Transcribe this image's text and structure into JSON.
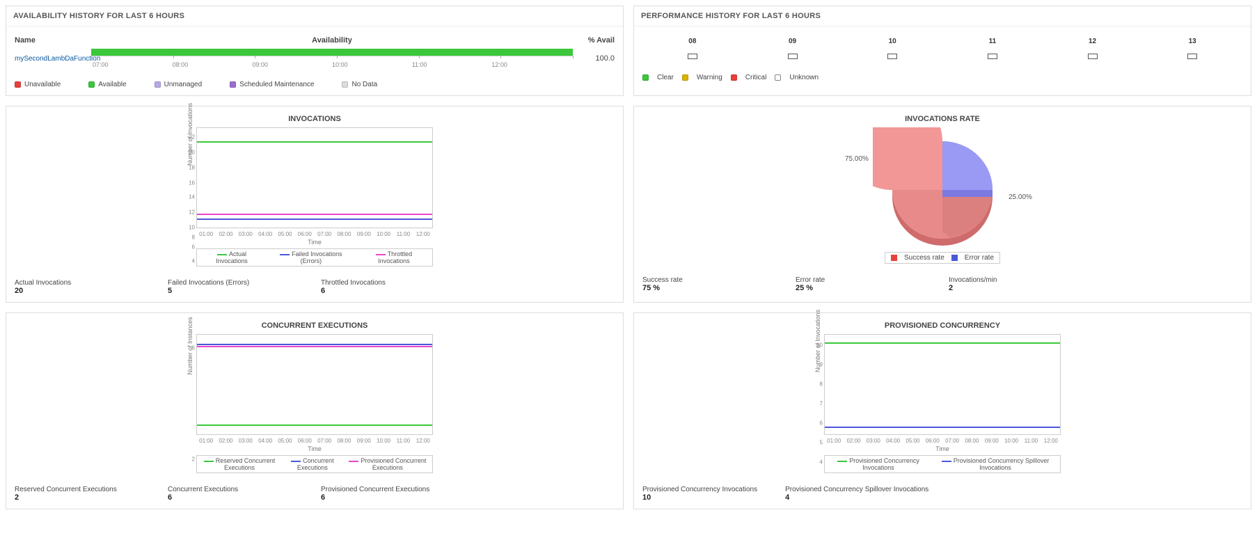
{
  "availability": {
    "title": "AVAILABILITY HISTORY FOR LAST 6 HOURS",
    "headers": {
      "name": "Name",
      "availability": "Availability",
      "pct": "% Avail"
    },
    "row": {
      "name": "mySecondLambDaFunction",
      "pct": "100.0"
    },
    "xticks": [
      "07:00",
      "08:00",
      "09:00",
      "10:00",
      "11:00",
      "12:00"
    ],
    "legend": {
      "unavailable": "Unavailable",
      "available": "Available",
      "unmanaged": "Unmanaged",
      "scheduled": "Scheduled Maintenance",
      "nodata": "No Data"
    }
  },
  "performance": {
    "title": "PERFORMANCE HISTORY FOR LAST 6 HOURS",
    "hours": [
      "08",
      "09",
      "10",
      "11",
      "12",
      "13"
    ],
    "legend": {
      "clear": "Clear",
      "warning": "Warning",
      "critical": "Critical",
      "unknown": "Unknown"
    }
  },
  "invocations": {
    "title": "INVOCATIONS",
    "ylabel": "Number of Invocations",
    "xlabel": "Time",
    "legend": {
      "actual": "Actual Invocations",
      "failed": "Failed Invocations (Errors)",
      "throttled": "Throttled Invocations"
    },
    "stats": {
      "actual_label": "Actual Invocations",
      "actual_value": "20",
      "failed_label": "Failed Invocations (Errors)",
      "failed_value": "5",
      "throttled_label": "Throttled Invocations",
      "throttled_value": "6"
    }
  },
  "invocations_rate": {
    "title": "INVOCATIONS RATE",
    "slice1": "75.00%",
    "slice2": "25.00%",
    "legend": {
      "success": "Success rate",
      "error": "Error rate"
    },
    "stats": {
      "success_label": "Success rate",
      "success_value": "75 %",
      "error_label": "Error rate",
      "error_value": "25 %",
      "rate_label": "Invocations/min",
      "rate_value": "2"
    }
  },
  "concurrent": {
    "title": "CONCURRENT EXECUTIONS",
    "ylabel": "Number of Instances",
    "xlabel": "Time",
    "legend": {
      "reserved": "Reserved Concurrent Executions",
      "concurrent": "Concurrent Executions",
      "provisioned": "Provisioned Concurrent Executions"
    },
    "stats": {
      "reserved_label": "Reserved Concurrent Executions",
      "reserved_value": "2",
      "concurrent_label": "Concurrent Executions",
      "concurrent_value": "6",
      "provisioned_label": "Provisioned Concurrent Executions",
      "provisioned_value": "6"
    }
  },
  "prov_conc": {
    "title": "PROVISIONED CONCURRENCY",
    "ylabel": "Number of Invocations",
    "xlabel": "Time",
    "legend": {
      "inv": "Provisioned Concurrency Invocations",
      "spill": "Provisioned Concurrency Spillover Invocations"
    },
    "stats": {
      "inv_label": "Provisioned Concurrency Invocations",
      "inv_value": "10",
      "spill_label": "Provisioned Concurrency Spillover Invocations",
      "spill_value": "4"
    }
  },
  "chart_xticks": [
    "01:00",
    "02:00",
    "03:00",
    "04:00",
    "05:00",
    "06:00",
    "07:00",
    "08:00",
    "09:00",
    "10:00",
    "11:00",
    "12:00"
  ],
  "chart_data": [
    {
      "type": "line",
      "title": "INVOCATIONS",
      "xlabel": "Time",
      "ylabel": "Number of Invocations",
      "x": [
        "01:00",
        "02:00",
        "03:00",
        "04:00",
        "05:00",
        "06:00",
        "07:00",
        "08:00",
        "09:00",
        "10:00",
        "11:00",
        "12:00"
      ],
      "ylim": [
        4,
        22
      ],
      "series": [
        {
          "name": "Actual Invocations",
          "color": "#3ac83a",
          "values": [
            20,
            20,
            20,
            20,
            20,
            20,
            20,
            20,
            20,
            20,
            20,
            20
          ]
        },
        {
          "name": "Failed Invocations (Errors)",
          "color": "#4a58d8",
          "values": [
            5,
            5,
            5,
            5,
            5,
            5,
            5,
            5,
            5,
            5,
            5,
            5
          ]
        },
        {
          "name": "Throttled Invocations",
          "color": "#e945c8",
          "values": [
            6,
            6,
            6,
            6,
            6,
            6,
            6,
            6,
            6,
            6,
            6,
            6
          ]
        }
      ]
    },
    {
      "type": "pie",
      "title": "INVOCATIONS RATE",
      "series": [
        {
          "name": "Success rate",
          "color": "#f28b8b",
          "value": 75
        },
        {
          "name": "Error rate",
          "color": "#8a8af0",
          "value": 25
        }
      ]
    },
    {
      "type": "line",
      "title": "CONCURRENT EXECUTIONS",
      "xlabel": "Time",
      "ylabel": "Number of Instances",
      "x": [
        "01:00",
        "02:00",
        "03:00",
        "04:00",
        "05:00",
        "06:00",
        "07:00",
        "08:00",
        "09:00",
        "10:00",
        "11:00",
        "12:00"
      ],
      "ylim": [
        2,
        6
      ],
      "series": [
        {
          "name": "Reserved Concurrent Executions",
          "color": "#3ac83a",
          "values": [
            2,
            2,
            2,
            2,
            2,
            2,
            2,
            2,
            2,
            2,
            2,
            2
          ]
        },
        {
          "name": "Concurrent Executions",
          "color": "#4a58d8",
          "values": [
            6,
            6,
            6,
            6,
            6,
            6,
            6,
            6,
            6,
            6,
            6,
            6
          ]
        },
        {
          "name": "Provisioned Concurrent Executions",
          "color": "#e945c8",
          "values": [
            6,
            6,
            6,
            6,
            6,
            6,
            6,
            6,
            6,
            6,
            6,
            6
          ]
        }
      ]
    },
    {
      "type": "line",
      "title": "PROVISIONED CONCURRENCY",
      "xlabel": "Time",
      "ylabel": "Number of Invocations",
      "x": [
        "01:00",
        "02:00",
        "03:00",
        "04:00",
        "05:00",
        "06:00",
        "07:00",
        "08:00",
        "09:00",
        "10:00",
        "11:00",
        "12:00"
      ],
      "ylim": [
        4,
        10
      ],
      "series": [
        {
          "name": "Provisioned Concurrency Invocations",
          "color": "#3ac83a",
          "values": [
            10,
            10,
            10,
            10,
            10,
            10,
            10,
            10,
            10,
            10,
            10,
            10
          ]
        },
        {
          "name": "Provisioned Concurrency Spillover Invocations",
          "color": "#4a58d8",
          "values": [
            4,
            4,
            4,
            4,
            4,
            4,
            4,
            4,
            4,
            4,
            4,
            4
          ]
        }
      ]
    }
  ]
}
